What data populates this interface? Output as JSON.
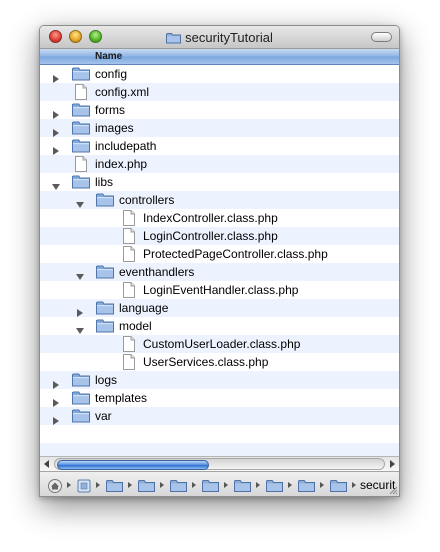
{
  "window": {
    "title": "securityTutorial"
  },
  "column_header": {
    "name": "Name"
  },
  "rows": [
    {
      "label": "config",
      "type": "folder",
      "depth": 0,
      "disclosure": "collapsed"
    },
    {
      "label": "config.xml",
      "type": "file",
      "depth": 0,
      "disclosure": "none"
    },
    {
      "label": "forms",
      "type": "folder",
      "depth": 0,
      "disclosure": "collapsed"
    },
    {
      "label": "images",
      "type": "folder",
      "depth": 0,
      "disclosure": "collapsed"
    },
    {
      "label": "includepath",
      "type": "folder",
      "depth": 0,
      "disclosure": "collapsed"
    },
    {
      "label": "index.php",
      "type": "file",
      "depth": 0,
      "disclosure": "none"
    },
    {
      "label": "libs",
      "type": "folder",
      "depth": 0,
      "disclosure": "expanded"
    },
    {
      "label": "controllers",
      "type": "folder",
      "depth": 1,
      "disclosure": "expanded"
    },
    {
      "label": "IndexController.class.php",
      "type": "file",
      "depth": 2,
      "disclosure": "none"
    },
    {
      "label": "LoginController.class.php",
      "type": "file",
      "depth": 2,
      "disclosure": "none"
    },
    {
      "label": "ProtectedPageController.class.php",
      "type": "file",
      "depth": 2,
      "disclosure": "none"
    },
    {
      "label": "eventhandlers",
      "type": "folder",
      "depth": 1,
      "disclosure": "expanded"
    },
    {
      "label": "LoginEventHandler.class.php",
      "type": "file",
      "depth": 2,
      "disclosure": "none"
    },
    {
      "label": "language",
      "type": "folder",
      "depth": 1,
      "disclosure": "collapsed"
    },
    {
      "label": "model",
      "type": "folder",
      "depth": 1,
      "disclosure": "expanded"
    },
    {
      "label": "CustomUserLoader.class.php",
      "type": "file",
      "depth": 2,
      "disclosure": "none"
    },
    {
      "label": "UserServices.class.php",
      "type": "file",
      "depth": 2,
      "disclosure": "none"
    },
    {
      "label": "logs",
      "type": "folder",
      "depth": 0,
      "disclosure": "collapsed"
    },
    {
      "label": "templates",
      "type": "folder",
      "depth": 0,
      "disclosure": "collapsed"
    },
    {
      "label": "var",
      "type": "folder",
      "depth": 0,
      "disclosure": "collapsed"
    }
  ],
  "path_bar": {
    "items": [
      "home-icon",
      "drive-icon",
      "folder-icon",
      "folder-icon",
      "folder-icon",
      "folder-icon",
      "folder-icon",
      "folder-icon",
      "folder-icon",
      "folder-icon"
    ],
    "current": "securit"
  },
  "colors": {
    "accent": "#7aa7df",
    "row_alt": "#edf3fe",
    "folder": "#7fa5d6"
  }
}
